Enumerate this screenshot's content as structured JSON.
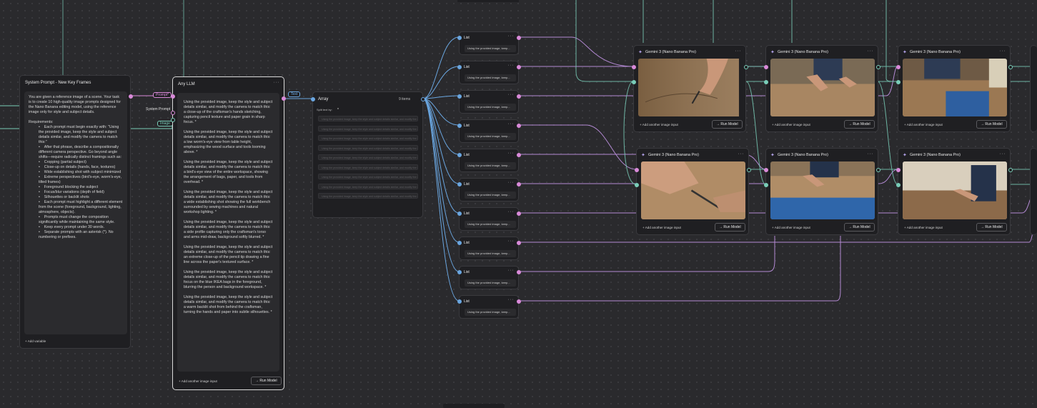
{
  "colors": {
    "prompt_wire": "#d98ad9",
    "image_wire": "#79cdb8",
    "text_wire": "#6aa6e0",
    "list_wire": "#b48ad4"
  },
  "system_node": {
    "title": "System Prompt - New Key Frames",
    "intro": "You are given a reference image of a scene. Your task is to create 10 high-quality image prompts designed for the Nano Banana editing model, using the reference image only for style and subject details.",
    "requirements_label": "Requirements:",
    "requirements": [
      "Each prompt must begin exactly with: \"Using the provided image, keep the style and subject details similar, and modify the camera to match this:\"",
      "After that phrase, describe a compositionally different camera perspective. Go beyond angle shifts—require radically distinct framings such as:",
      "Cropping (partial subject)",
      "Close-up on details (hands, face, textures)",
      "Wide establishing shot with subject minimized",
      "Extreme perspectives (bird's-eye, worm's-eye, tilted frames)",
      "Foreground blocking the subject",
      "Focus/blur variations (depth of field)",
      "Silhouettes or backlit shots",
      "Each prompt must highlight a different element from the scene (foreground, background, lighting, atmosphere, objects).",
      "Prompts must change the composition significantly while maintaining the same style.",
      "Keep every prompt under 30 words.",
      "Separate prompts with an asterisk (*). No numbering or prefixes."
    ],
    "add_variable": "Add variable"
  },
  "port_labels": {
    "prompt": "Prompt*",
    "system_prompt": "System Prompt",
    "image": "Image",
    "text": "Text"
  },
  "llm_node": {
    "title": "Any LLM",
    "outputs": [
      "Using the provided image, keep the style and subject details similar, and modify the camera to match this: a close-up of the craftsman's hands sketching, capturing pencil texture and paper grain in sharp focus. *",
      "Using the provided image, keep the style and subject details similar, and modify the camera to match this: a low worm's-eye view from table height, emphasizing the wood surface and tools looming above. *",
      "Using the provided image, keep the style and subject details similar, and modify the camera to match this: a bird's-eye view of the entire workspace, showing the arrangement of bags, paper, and tools from overhead. *",
      "Using the provided image, keep the style and subject details similar, and modify the camera to match this: a wide establishing shot showing the full workbench surrounded by sewing machines and natural workshop lighting. *",
      "Using the provided image, keep the style and subject details similar, and modify the camera to match this: a side profile capturing only the craftsman's torso and arms mid-draw, background softly blurred. *",
      "Using the provided image, keep the style and subject details similar, and modify the camera to match this: an extreme close-up of the pencil tip drawing a fine line across the paper's textured surface. *",
      "Using the provided image, keep the style and subject details similar, and modify the camera to match this: focus on the blue IKEA bags in the foreground, blurring the person and background workspace. *",
      "Using the provided image, keep the style and subject details similar, and modify the camera to match this: a warm backlit shot from behind the craftsman, turning the hands and paper into subtle silhouettes. *"
    ],
    "add_image_input": "Add another image input",
    "run": "Run Model"
  },
  "array_node": {
    "title": "Array",
    "count": "9 items",
    "split_label": "Split text by:",
    "split_value": "*",
    "items": [
      "Using the provided image, keep the style and subject details similar, and modify the camera to match this: a close-up",
      "Using the provided image, keep the style and subject details similar, and modify the camera to match this: a low worm",
      "Using the provided image, keep the style and subject details similar, and modify the camera to match this: a bird's-eye",
      "Using the provided image, keep the style and subject details similar, and modify the camera to match this: a wide shot",
      "Using the provided image, keep the style and subject details similar, and modify the camera to match this: a side profile",
      "Using the provided image, keep the style and subject details similar, and modify the camera to match this: an extreme",
      "Using the provided image, keep the style and subject details similar, and modify the camera to match this: focus on",
      "Using the provided image, keep the style and subject details similar, and modify the camera to match this: a warm backlit",
      "Using the provided image, keep the style and subject details similar, and modify the camera to match this: silhouette"
    ]
  },
  "list_nodes": {
    "title": "List",
    "value": "Using the provided image, keep...",
    "count": 10
  },
  "gen_nodes": {
    "title": "Gemini 3 (Nano Banana Pro)",
    "add_image_input": "Add another image input",
    "run": "Run Model"
  }
}
